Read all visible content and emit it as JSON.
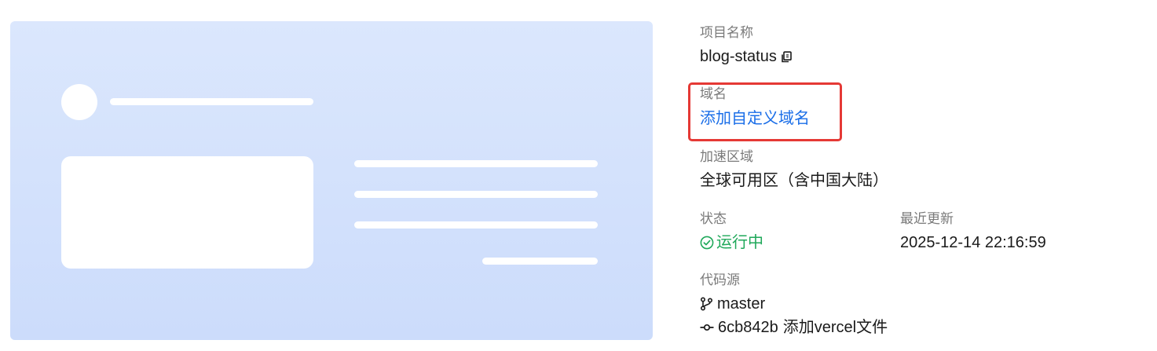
{
  "project": {
    "name_label": "项目名称",
    "name_value": "blog-status",
    "copy_icon": "copy-icon"
  },
  "domain": {
    "label": "域名",
    "add_link": "添加自定义域名"
  },
  "region": {
    "label": "加速区域",
    "value": "全球可用区（含中国大陆）"
  },
  "status": {
    "label": "状态",
    "value": "运行中",
    "icon": "check-circle-icon",
    "color": "#1fa85a"
  },
  "updated": {
    "label": "最近更新",
    "value": "2025-12-14 22:16:59"
  },
  "source": {
    "label": "代码源",
    "branch_icon": "git-branch-icon",
    "branch": "master",
    "commit_icon": "git-commit-icon",
    "commit_hash": "6cb842b",
    "commit_message": "添加vercel文件"
  },
  "colors": {
    "link": "#1a6ee8",
    "highlight": "#e53935",
    "preview_bg": "#d6e4fd"
  }
}
